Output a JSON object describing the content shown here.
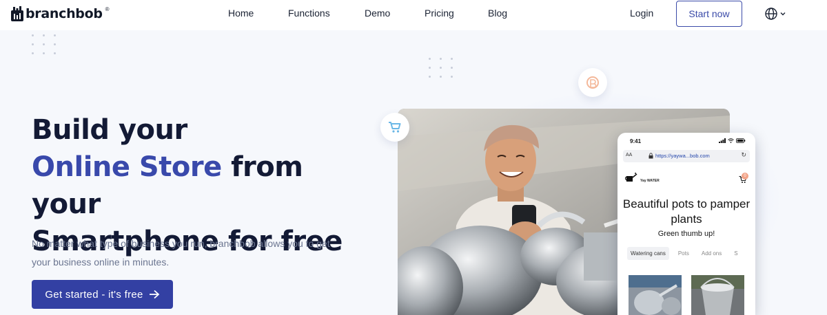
{
  "nav": {
    "logo_text": "branchbob",
    "logo_reg": "®",
    "links": [
      "Home",
      "Functions",
      "Demo",
      "Pricing",
      "Blog"
    ],
    "login_label": "Login",
    "start_label": "Start now",
    "language_icon": "globe-icon"
  },
  "hero": {
    "headline_line1": "Build your",
    "headline_accent": "Online Store",
    "headline_line2_rest": " from your",
    "headline_line3": "Smartphone for free",
    "subtext": "No matter what type of business you run, branchbob allows you to get your business online in minutes.",
    "cta_label": "Get started - it's free",
    "cta_icon": "arrow-right-icon"
  },
  "phone": {
    "time": "9:41",
    "url_aa": "AA",
    "url": "https://yaywa...bob.com",
    "brand": "Yay WATER",
    "cart_count": "0",
    "title": "Beautiful pots to pamper plants",
    "subtitle": "Green thumb up!",
    "tabs": [
      "Watering cans",
      "Pots",
      "Add ons",
      "S"
    ]
  },
  "colors": {
    "accent": "#3949ab",
    "cta_bg": "#3340a3",
    "badge": "#f2a489"
  },
  "bubbles": [
    "cart-icon",
    "coin-icon"
  ]
}
